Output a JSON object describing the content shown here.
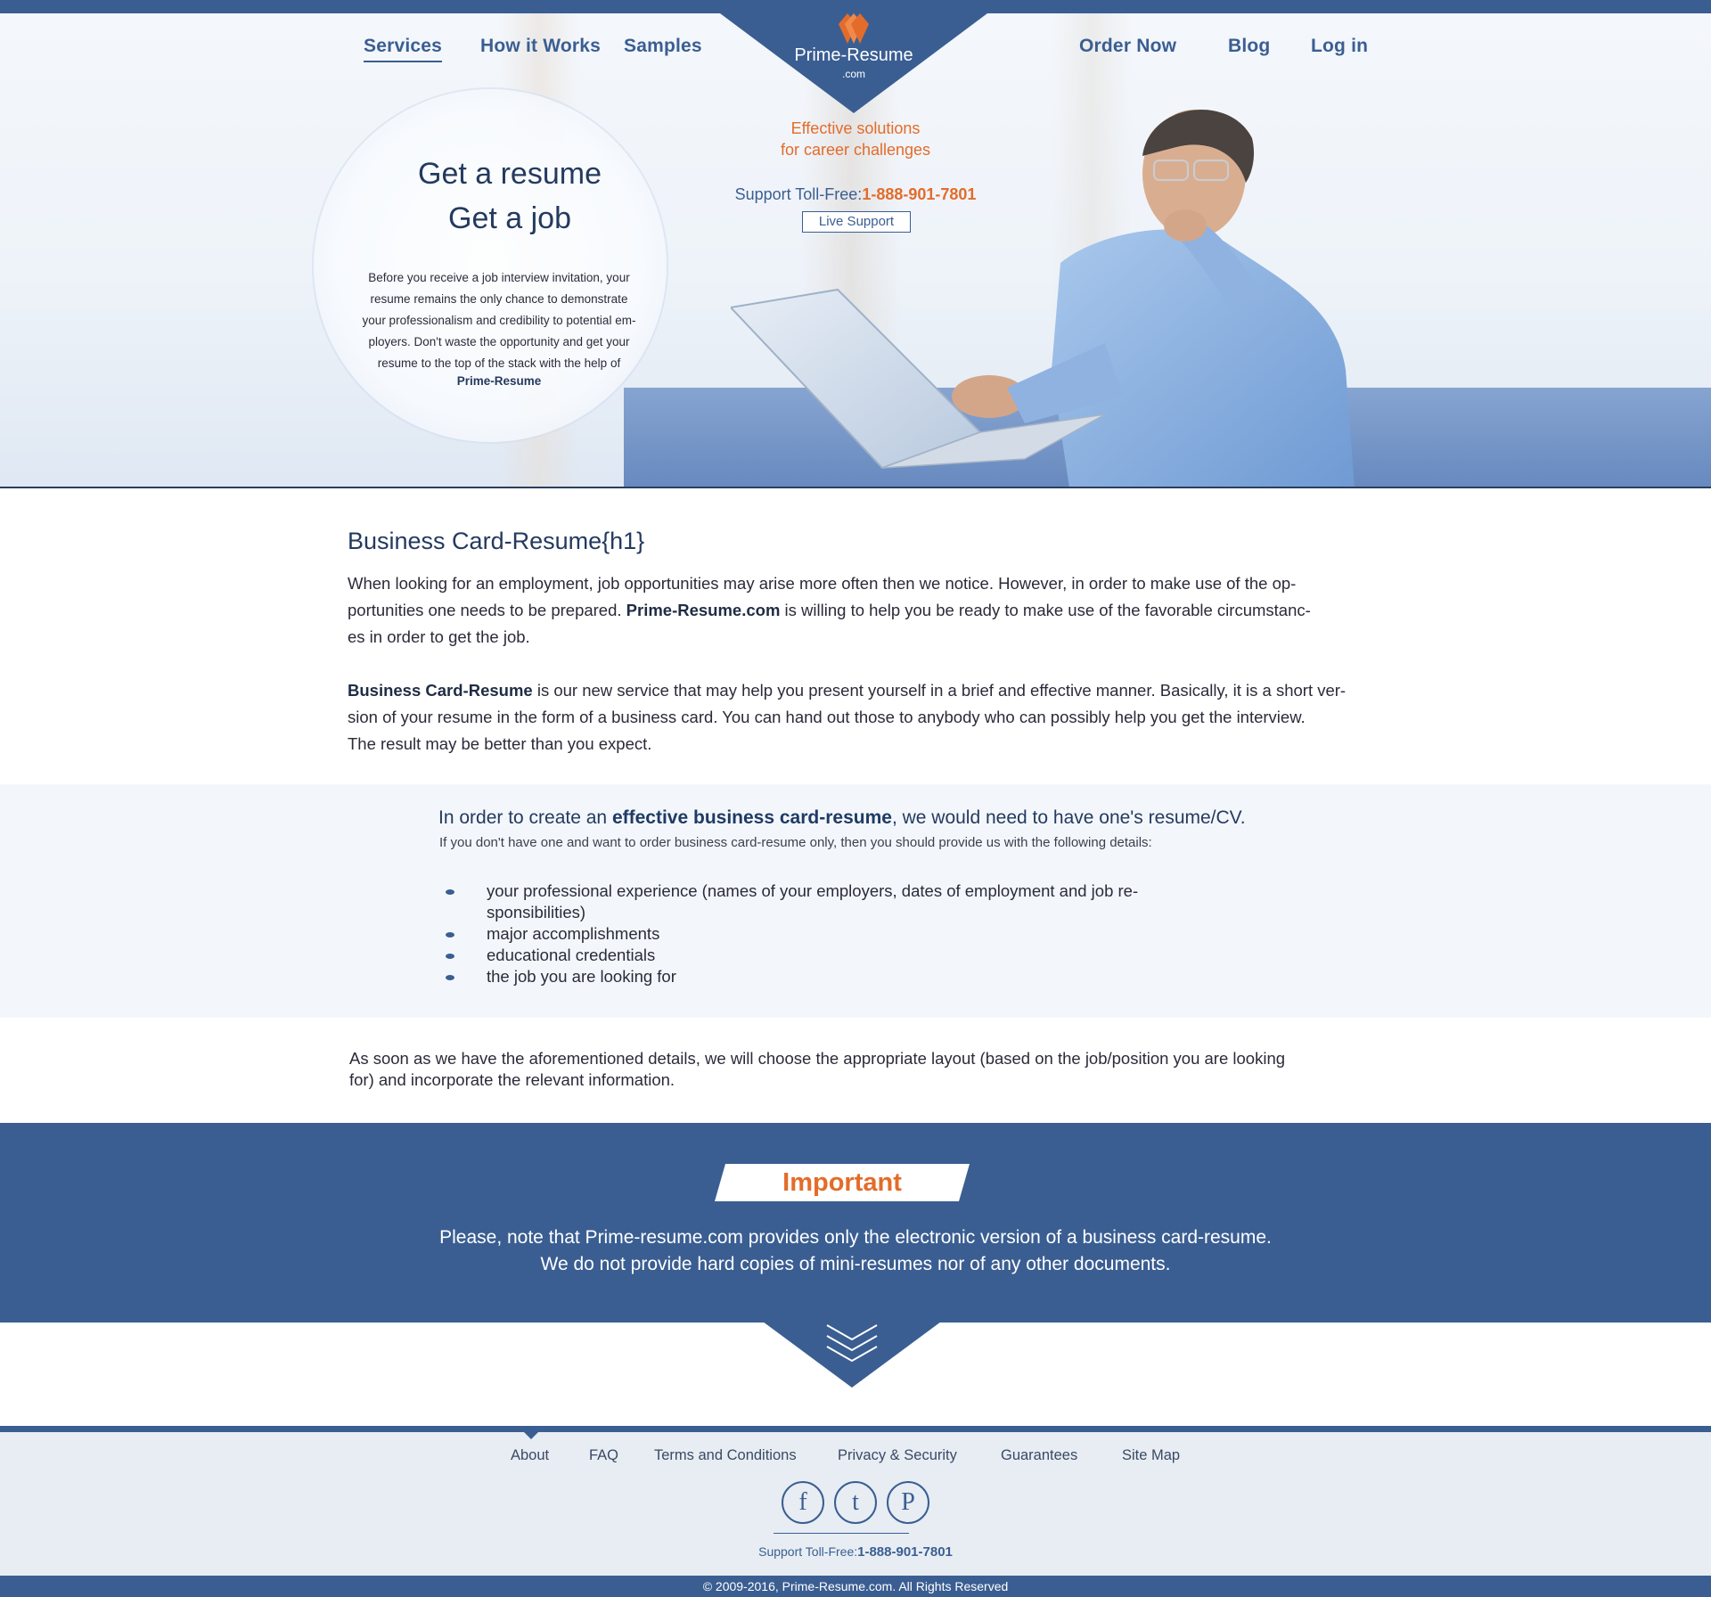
{
  "nav": {
    "left": [
      {
        "label": "Services",
        "active": true
      },
      {
        "label": "How it Works"
      },
      {
        "label": "Samples"
      }
    ],
    "right": [
      {
        "label": "Order Now"
      },
      {
        "label": "Blog"
      },
      {
        "label": "Log in"
      }
    ]
  },
  "logo": {
    "name": "Prime-Resume",
    "suffix": ".com",
    "icon": "diamond-logo-icon"
  },
  "hero": {
    "tagline_1": "Effective solutions",
    "tagline_2": "for career challenges",
    "support_label": "Support Toll-Free:",
    "support_phone": "1-888-901-7801",
    "live_support": "Live Support",
    "heading_1": "Get a resume",
    "heading_2": "Get a job",
    "text_lines": [
      "Before you receive a job interview invitation, your",
      "resume remains the only chance to demonstrate",
      "your professionalism and credibility to potential em-",
      "ployers. Don't waste the opportunity and get your",
      "resume to the top of the stack with the help of"
    ],
    "brand": "Prime-Resume"
  },
  "content": {
    "h1": "Business Card-Resume{h1}",
    "p1_lines": [
      "When looking for an employment, job opportunities may arise more often then we notice. However, in order to make use of the op-",
      "portunities one needs to be prepared.",
      "Prime-Resume.com",
      " is willing to help you be ready to make use of the favorable circumstanc-",
      "es in order to get the job."
    ],
    "p2_bold": "Business Card-Resume",
    "p2_lines": [
      " is our new service that may help you present yourself in a brief and effective manner. Basically, it is a short ver-",
      "sion of your resume in the form of a business card. You can hand out those to anybody who can possibly help you get the interview.",
      "The result may be better than you expect."
    ]
  },
  "band": {
    "heading_pre": "In order to create an ",
    "heading_bold": "effective business card-resume",
    "heading_post": ", we would need to have one's resume/CV.",
    "sub": "If you don't have one and want to order business card-resume only, then you should provide us with the following details:",
    "bullets": [
      "your professional experience (names of your employers, dates of employment and job re-\nsponsibilities)",
      "major accomplishments",
      "educational credentials",
      "the job you are looking for"
    ]
  },
  "after_text_lines": [
    "As soon as we have the aforementioned details, we will choose the appropriate layout (based on the job/position you are looking",
    "for) and incorporate the relevant information."
  ],
  "important": {
    "label": "Important",
    "line_1": "Please, note that Prime-resume.com provides only the electronic version of a business card-resume.",
    "line_2": "We do not provide hard copies of mini-resumes nor of any other documents."
  },
  "footer": {
    "links": [
      "About",
      "FAQ",
      "Terms and Conditions",
      "Privacy & Security",
      "Guarantees",
      "Site Map"
    ],
    "social": [
      {
        "icon": "facebook-icon",
        "glyph": "f"
      },
      {
        "icon": "tumblr-icon",
        "glyph": "t"
      },
      {
        "icon": "pinterest-icon",
        "glyph": "P"
      }
    ],
    "support_label": "Support Toll-Free:",
    "support_phone": "1-888-901-7801",
    "copyright": "© 2009-2016, Prime-Resume.com. All Rights Reserved"
  },
  "colors": {
    "brand_blue": "#3a5e92",
    "accent_orange": "#e36c2a",
    "dark_text": "#2b2b3a"
  }
}
